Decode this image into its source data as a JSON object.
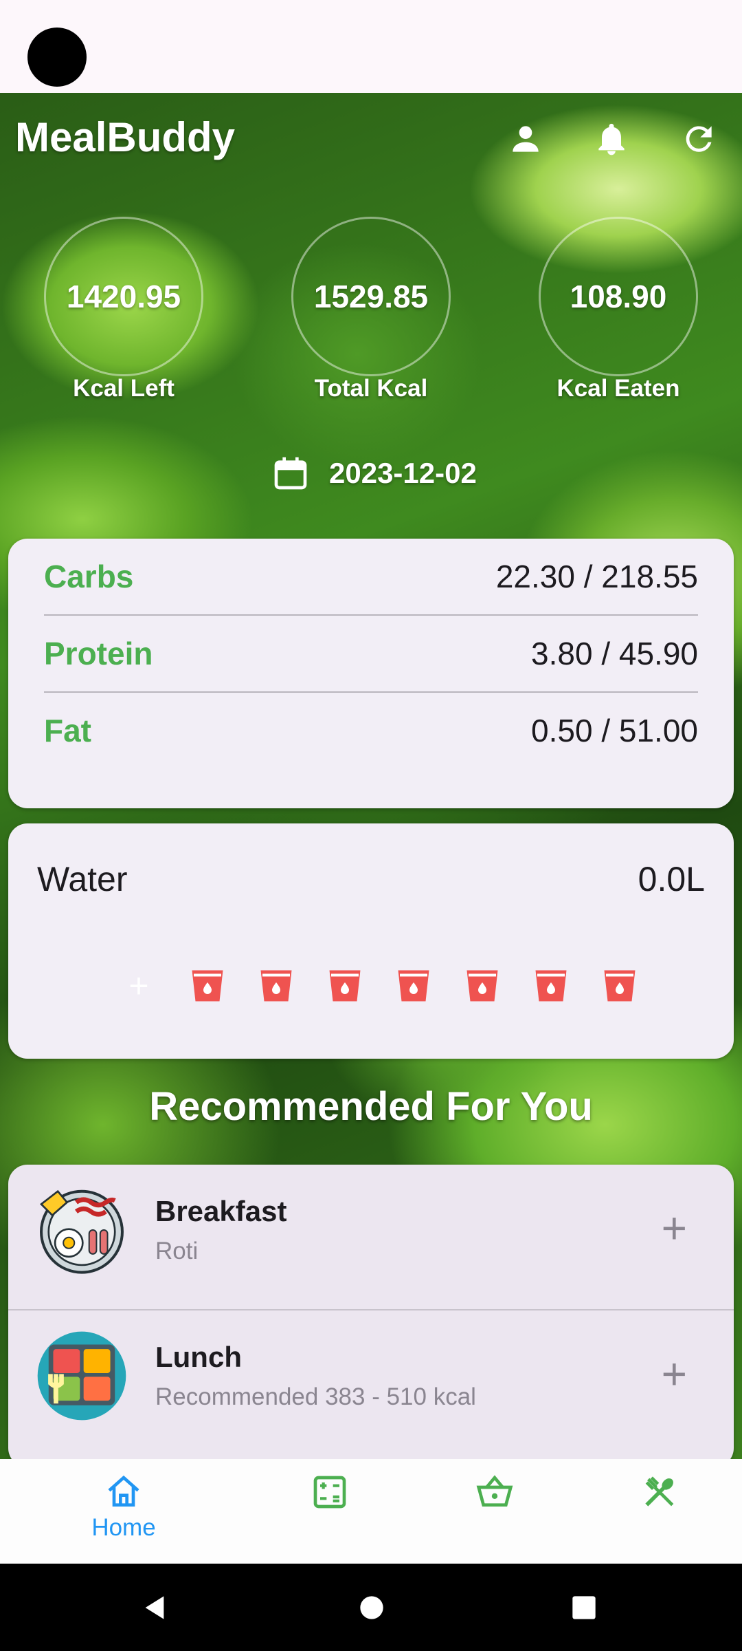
{
  "app": {
    "title": "MealBuddy"
  },
  "header": {
    "icons": [
      "person-icon",
      "bell-icon",
      "refresh-icon"
    ]
  },
  "stats": {
    "kcal_left": {
      "value": "1420.95",
      "label": "Kcal Left"
    },
    "total_kcal": {
      "value": "1529.85",
      "label": "Total Kcal"
    },
    "kcal_eaten": {
      "value": "108.90",
      "label": "Kcal Eaten"
    }
  },
  "date": "2023-12-02",
  "macros": [
    {
      "name": "Carbs",
      "value": "22.30 / 218.55"
    },
    {
      "name": "Protein",
      "value": "3.80 / 45.90"
    },
    {
      "name": "Fat",
      "value": "0.50 / 51.00"
    }
  ],
  "water": {
    "title": "Water",
    "amount": "0.0L",
    "add_label": "+",
    "glasses_count": 7
  },
  "recommended": {
    "title": "Recommended For You",
    "meals": [
      {
        "name": "Breakfast",
        "subtitle": "Roti",
        "add_label": "+"
      },
      {
        "name": "Lunch",
        "subtitle": "Recommended 383 - 510 kcal",
        "add_label": "+"
      }
    ]
  },
  "bottom_nav": {
    "items": [
      {
        "label": "Home",
        "icon": "home-icon",
        "active": true
      },
      {
        "label": "",
        "icon": "calculator-icon",
        "active": false
      },
      {
        "label": "",
        "icon": "basket-icon",
        "active": false
      },
      {
        "label": "",
        "icon": "utensils-icon",
        "active": false
      }
    ]
  },
  "colors": {
    "accent_green": "#4caf50",
    "active_blue": "#2196f3",
    "water_red": "#ef5350",
    "card_bg": "#f2eef6"
  }
}
